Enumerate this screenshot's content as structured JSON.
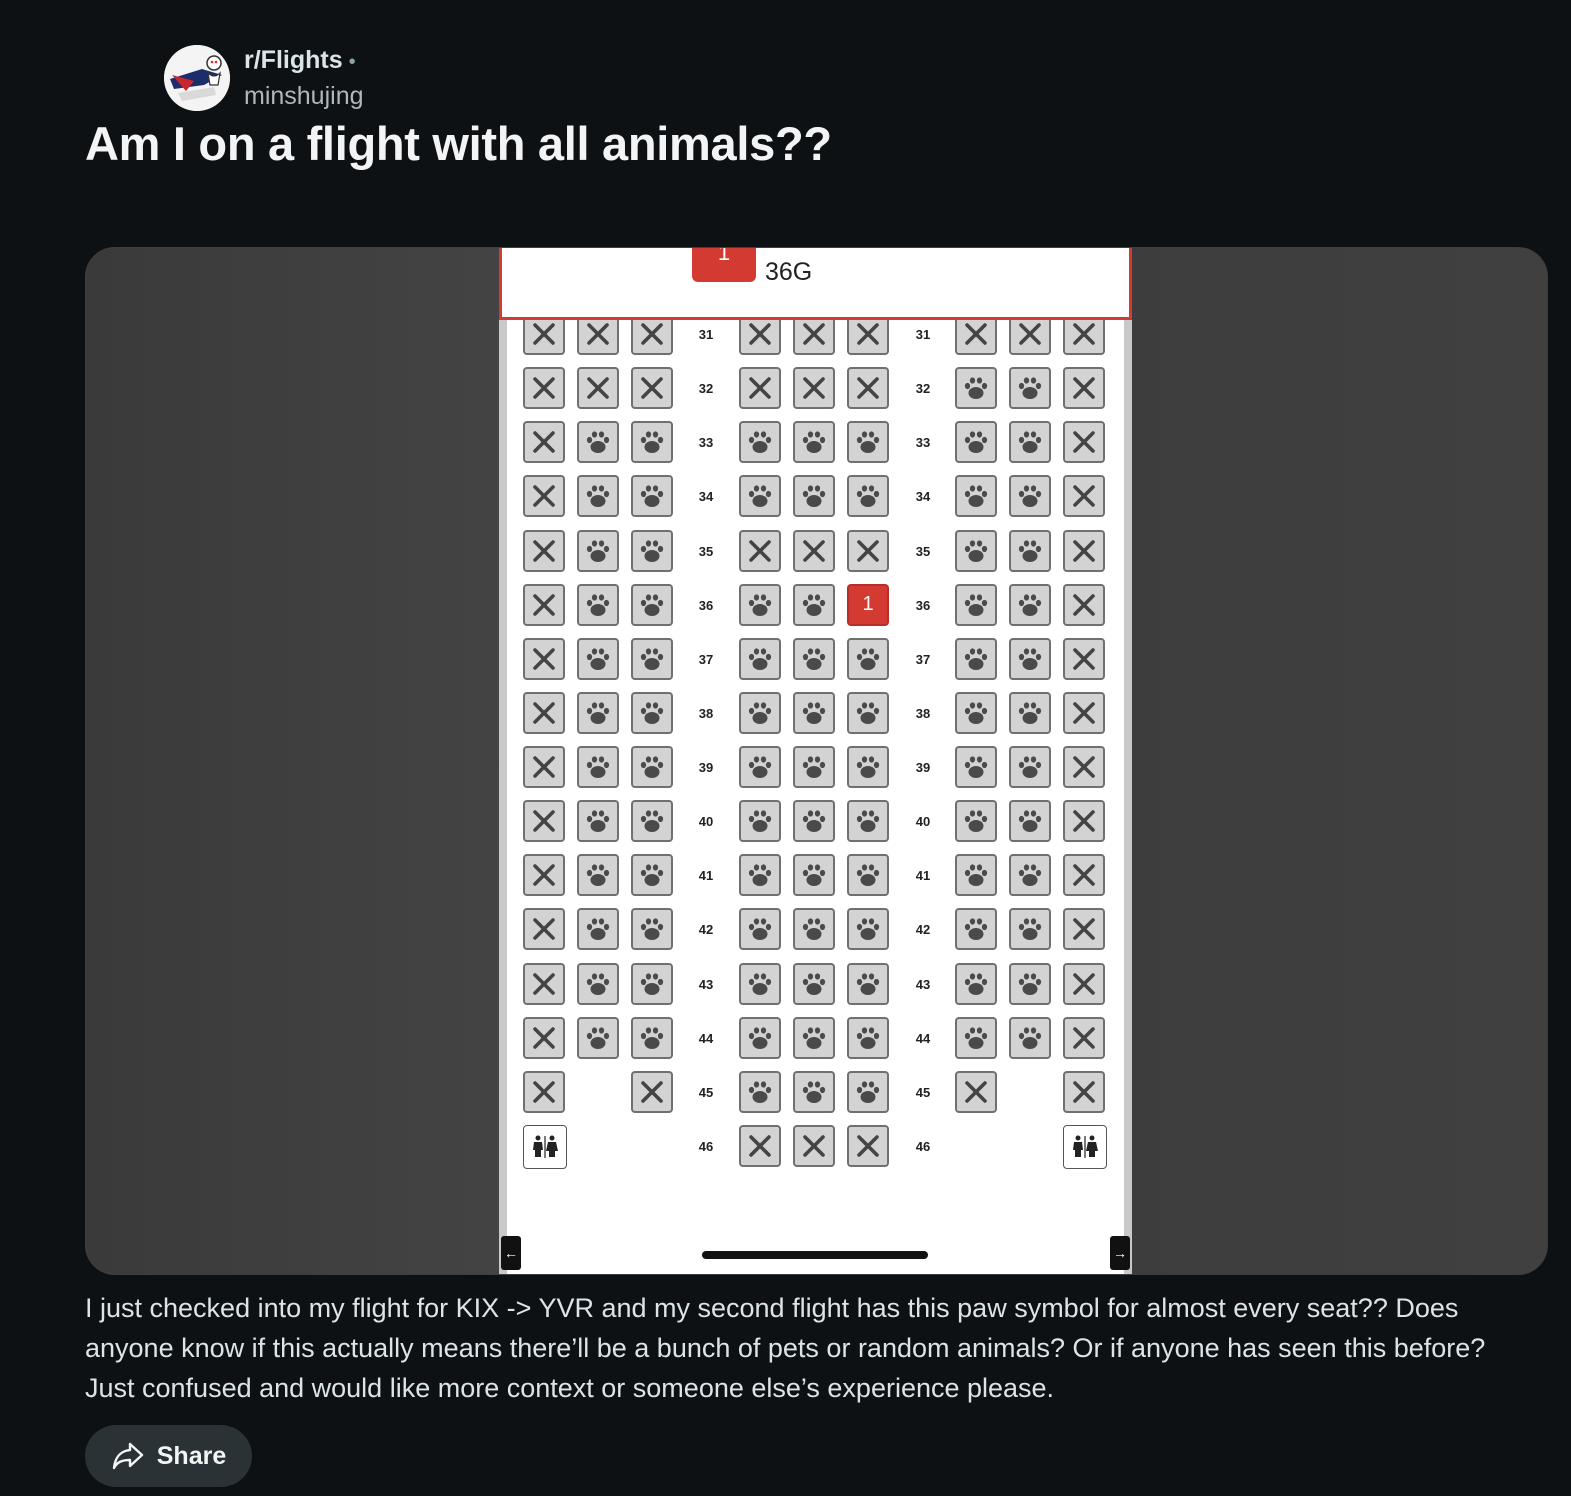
{
  "post": {
    "subreddit": "r/Flights",
    "separator": "•",
    "author": "minshujing",
    "title": "Am I on a flight with all animals??",
    "body": "I just checked into my flight for KIX -> YVR and my second flight has this paw symbol for almost every seat?? Does anyone know if this actually means there’ll be a bunch of pets or random animals? Or if anyone has seen this before? Just confused and would like more context or someone else’s experience please.",
    "share_label": "Share"
  },
  "seatmap": {
    "passenger_badge": "1",
    "selected_seat": "36G",
    "selected_seat_badge": "1",
    "rows": [
      {
        "num": "31",
        "seats": [
          "x",
          "x",
          "x",
          "x",
          "x",
          "x",
          "x",
          "x",
          "x"
        ]
      },
      {
        "num": "32",
        "seats": [
          "x",
          "x",
          "x",
          "x",
          "x",
          "x",
          "paw",
          "paw",
          "x"
        ]
      },
      {
        "num": "33",
        "seats": [
          "x",
          "paw",
          "paw",
          "paw",
          "paw",
          "paw",
          "paw",
          "paw",
          "x"
        ]
      },
      {
        "num": "34",
        "seats": [
          "x",
          "paw",
          "paw",
          "paw",
          "paw",
          "paw",
          "paw",
          "paw",
          "x"
        ]
      },
      {
        "num": "35",
        "seats": [
          "x",
          "paw",
          "paw",
          "x",
          "x",
          "x",
          "paw",
          "paw",
          "x"
        ]
      },
      {
        "num": "36",
        "seats": [
          "x",
          "paw",
          "paw",
          "paw",
          "paw",
          "sel",
          "paw",
          "paw",
          "x"
        ]
      },
      {
        "num": "37",
        "seats": [
          "x",
          "paw",
          "paw",
          "paw",
          "paw",
          "paw",
          "paw",
          "paw",
          "x"
        ]
      },
      {
        "num": "38",
        "seats": [
          "x",
          "paw",
          "paw",
          "paw",
          "paw",
          "paw",
          "paw",
          "paw",
          "x"
        ]
      },
      {
        "num": "39",
        "seats": [
          "x",
          "paw",
          "paw",
          "paw",
          "paw",
          "paw",
          "paw",
          "paw",
          "x"
        ]
      },
      {
        "num": "40",
        "seats": [
          "x",
          "paw",
          "paw",
          "paw",
          "paw",
          "paw",
          "paw",
          "paw",
          "x"
        ]
      },
      {
        "num": "41",
        "seats": [
          "x",
          "paw",
          "paw",
          "paw",
          "paw",
          "paw",
          "paw",
          "paw",
          "x"
        ]
      },
      {
        "num": "42",
        "seats": [
          "x",
          "paw",
          "paw",
          "paw",
          "paw",
          "paw",
          "paw",
          "paw",
          "x"
        ]
      },
      {
        "num": "43",
        "seats": [
          "x",
          "paw",
          "paw",
          "paw",
          "paw",
          "paw",
          "paw",
          "paw",
          "x"
        ]
      },
      {
        "num": "44",
        "seats": [
          "x",
          "paw",
          "paw",
          "paw",
          "paw",
          "paw",
          "paw",
          "paw",
          "x"
        ]
      },
      {
        "num": "45",
        "seats": [
          "x",
          "",
          "x",
          "paw",
          "paw",
          "paw",
          "x",
          "",
          "x"
        ]
      },
      {
        "num": "46",
        "seats": [
          "wc",
          "",
          "",
          "x",
          "x",
          "x",
          "",
          "",
          "wc"
        ]
      }
    ],
    "legend": {
      "x": "unavailable-seat-icon",
      "paw": "paw-icon",
      "wc": "restroom-icon"
    }
  },
  "colors": {
    "background": "#0e1113",
    "accent_red": "#d33b32",
    "seat_gray": "#d3d3d3"
  }
}
